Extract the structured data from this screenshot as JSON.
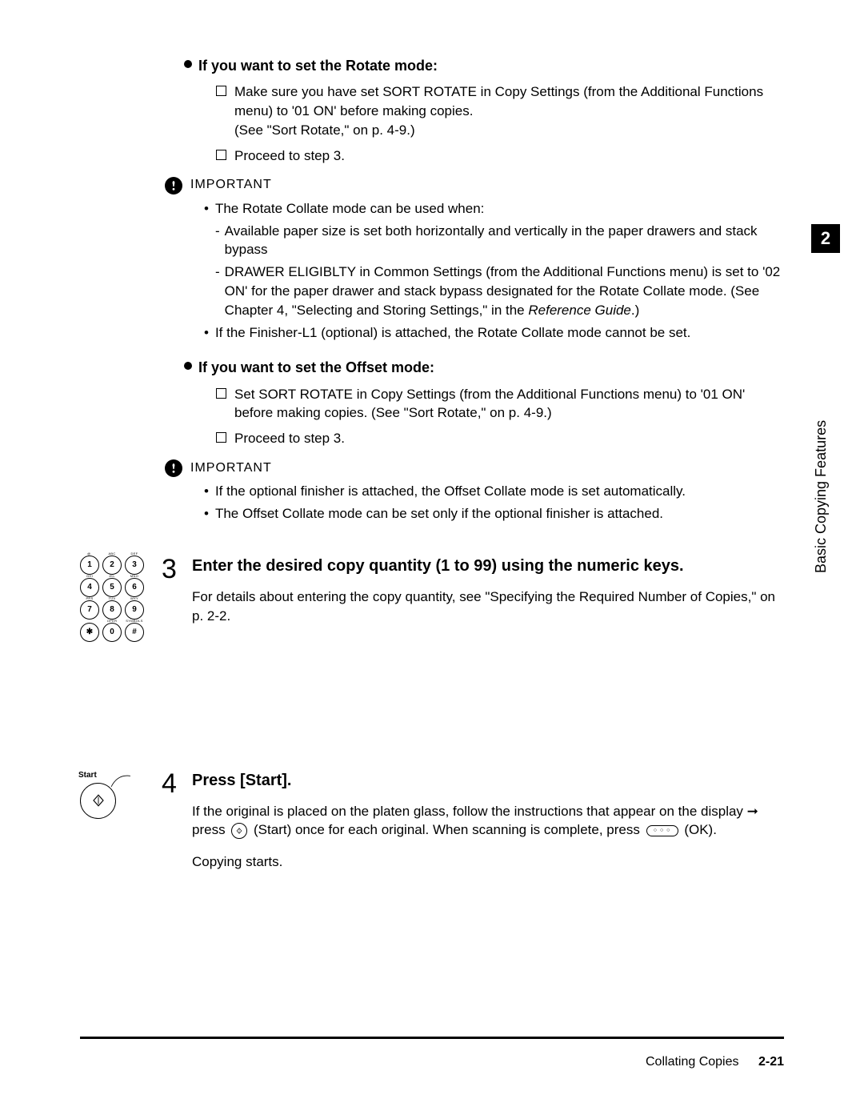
{
  "sections": {
    "rotate": {
      "title": "If you want to set the Rotate mode:",
      "check1": "Make sure you have set SORT ROTATE in Copy Settings (from the Additional Functions menu) to '01 ON' before making copies.",
      "check1b": "(See \"Sort Rotate,\" on p. 4-9.)",
      "check2": "Proceed to step 3."
    },
    "important1": {
      "label": "IMPORTANT",
      "b1": "The Rotate Collate mode can be used when:",
      "d1": "Available paper size is set both horizontally and vertically in the paper drawers and stack bypass",
      "d2a": "DRAWER ELIGIBLTY in Common Settings (from the Additional Functions menu) is set to '02 ON' for the paper drawer and stack bypass designated for the Rotate Collate mode. (See Chapter 4, \"Selecting and Storing Settings,\" in the ",
      "d2b": "Reference Guide",
      "d2c": ".)",
      "b2": "If the Finisher-L1 (optional) is attached, the Rotate Collate mode cannot be set."
    },
    "offset": {
      "title": "If you want to set the Offset mode:",
      "check1": "Set SORT ROTATE in Copy Settings (from the Additional Functions menu) to '01 ON' before making copies. (See \"Sort Rotate,\" on p. 4-9.)",
      "check2": "Proceed to step 3."
    },
    "important2": {
      "label": "IMPORTANT",
      "b1": "If the optional finisher is attached, the Offset Collate mode is set automatically.",
      "b2": "The Offset Collate mode can be set only if the optional finisher is attached."
    }
  },
  "step3": {
    "number": "3",
    "title": "Enter the desired copy quantity (1 to 99) using the numeric keys.",
    "body": "For details about entering the copy quantity, see \"Specifying the Required Number of Copies,\" on p. 2-2."
  },
  "step4": {
    "number": "4",
    "title": "Press [Start].",
    "body1": "If the original is placed on the platen glass, follow the instructions that appear on the display ",
    "body2": " press ",
    "body3": " (Start) once for each original. When scanning is complete, press ",
    "body4": " (OK).",
    "body5": "Copying starts."
  },
  "keypad": {
    "keys": [
      {
        "n": "1",
        "s": "@."
      },
      {
        "n": "2",
        "s": "ABC"
      },
      {
        "n": "3",
        "s": "DEF"
      },
      {
        "n": "4",
        "s": "GHI"
      },
      {
        "n": "5",
        "s": "JKL"
      },
      {
        "n": "6",
        "s": "MNO"
      },
      {
        "n": "7",
        "s": "PRS"
      },
      {
        "n": "8",
        "s": "TUV"
      },
      {
        "n": "9",
        "s": "WXY"
      },
      {
        "n": "",
        "s": ""
      },
      {
        "n": "0",
        "s": "OPER"
      },
      {
        "n": "#",
        "s": "SYMBOLS"
      }
    ],
    "star": "✱"
  },
  "start_button": {
    "label": "Start"
  },
  "side_tab": {
    "number": "2",
    "text": "Basic Copying Features"
  },
  "footer": {
    "section": "Collating Copies",
    "page": "2-21"
  },
  "chart_data": null
}
